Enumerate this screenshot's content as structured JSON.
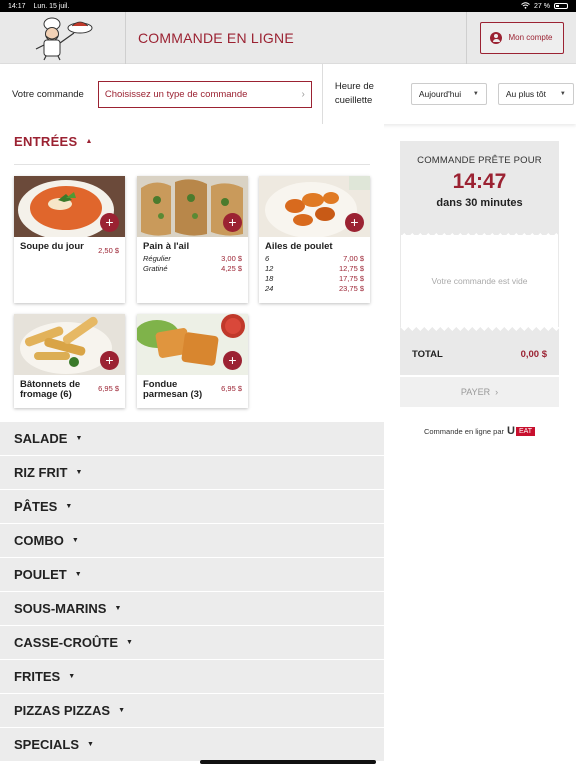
{
  "status_bar": {
    "time": "14:17",
    "date": "Lun. 15 juil.",
    "battery": "27 %"
  },
  "header": {
    "title": "COMMANDE EN LIGNE",
    "account_label": "Mon compte"
  },
  "order_bar": {
    "order_label": "Votre commande",
    "order_placeholder": "Choisissez un type de commande",
    "pickup_label": "Heure de cueillette",
    "day_value": "Aujourd'hui",
    "time_value": "Au plus tôt"
  },
  "menu": {
    "open_category": "ENTRÉES",
    "items": [
      {
        "name": "Soupe du jour",
        "price": "2,50 $",
        "variants": []
      },
      {
        "name": "Pain à l'ail",
        "price": "",
        "variants": [
          {
            "label": "Régulier",
            "price": "3,00 $"
          },
          {
            "label": "Gratiné",
            "price": "4,25 $"
          }
        ]
      },
      {
        "name": "Ailes de poulet",
        "price": "",
        "variants": [
          {
            "label": "6",
            "price": "7,00 $"
          },
          {
            "label": "12",
            "price": "12,75 $"
          },
          {
            "label": "18",
            "price": "17,75 $"
          },
          {
            "label": "24",
            "price": "23,75 $"
          }
        ]
      },
      {
        "name": "Bâtonnets de fromage (6)",
        "price": "6,95 $",
        "variants": []
      },
      {
        "name": "Fondue parmesan (3)",
        "price": "6,95 $",
        "variants": []
      }
    ],
    "add_symbol": "+",
    "categories": [
      "SALADE",
      "RIZ FRIT",
      "PÂTES",
      "COMBO",
      "POULET",
      "SOUS-MARINS",
      "CASSE-CROÛTE",
      "FRITES",
      "PIZZAS PIZZAS",
      "SPECIALS"
    ]
  },
  "cart": {
    "ready_label": "COMMANDE PRÊTE POUR",
    "ready_time": "14:47",
    "ready_in": "dans 30 minutes",
    "empty_text": "Votre commande est vide",
    "total_label": "TOTAL",
    "total_value": "0,00 $",
    "pay_label": "PAYER"
  },
  "footer": {
    "powered_by": "Commande en ligne par",
    "brand_u": "U",
    "brand_eat": "EAT"
  },
  "colors": {
    "accent": "#9b2232",
    "header_bg": "#e9e9e9"
  }
}
